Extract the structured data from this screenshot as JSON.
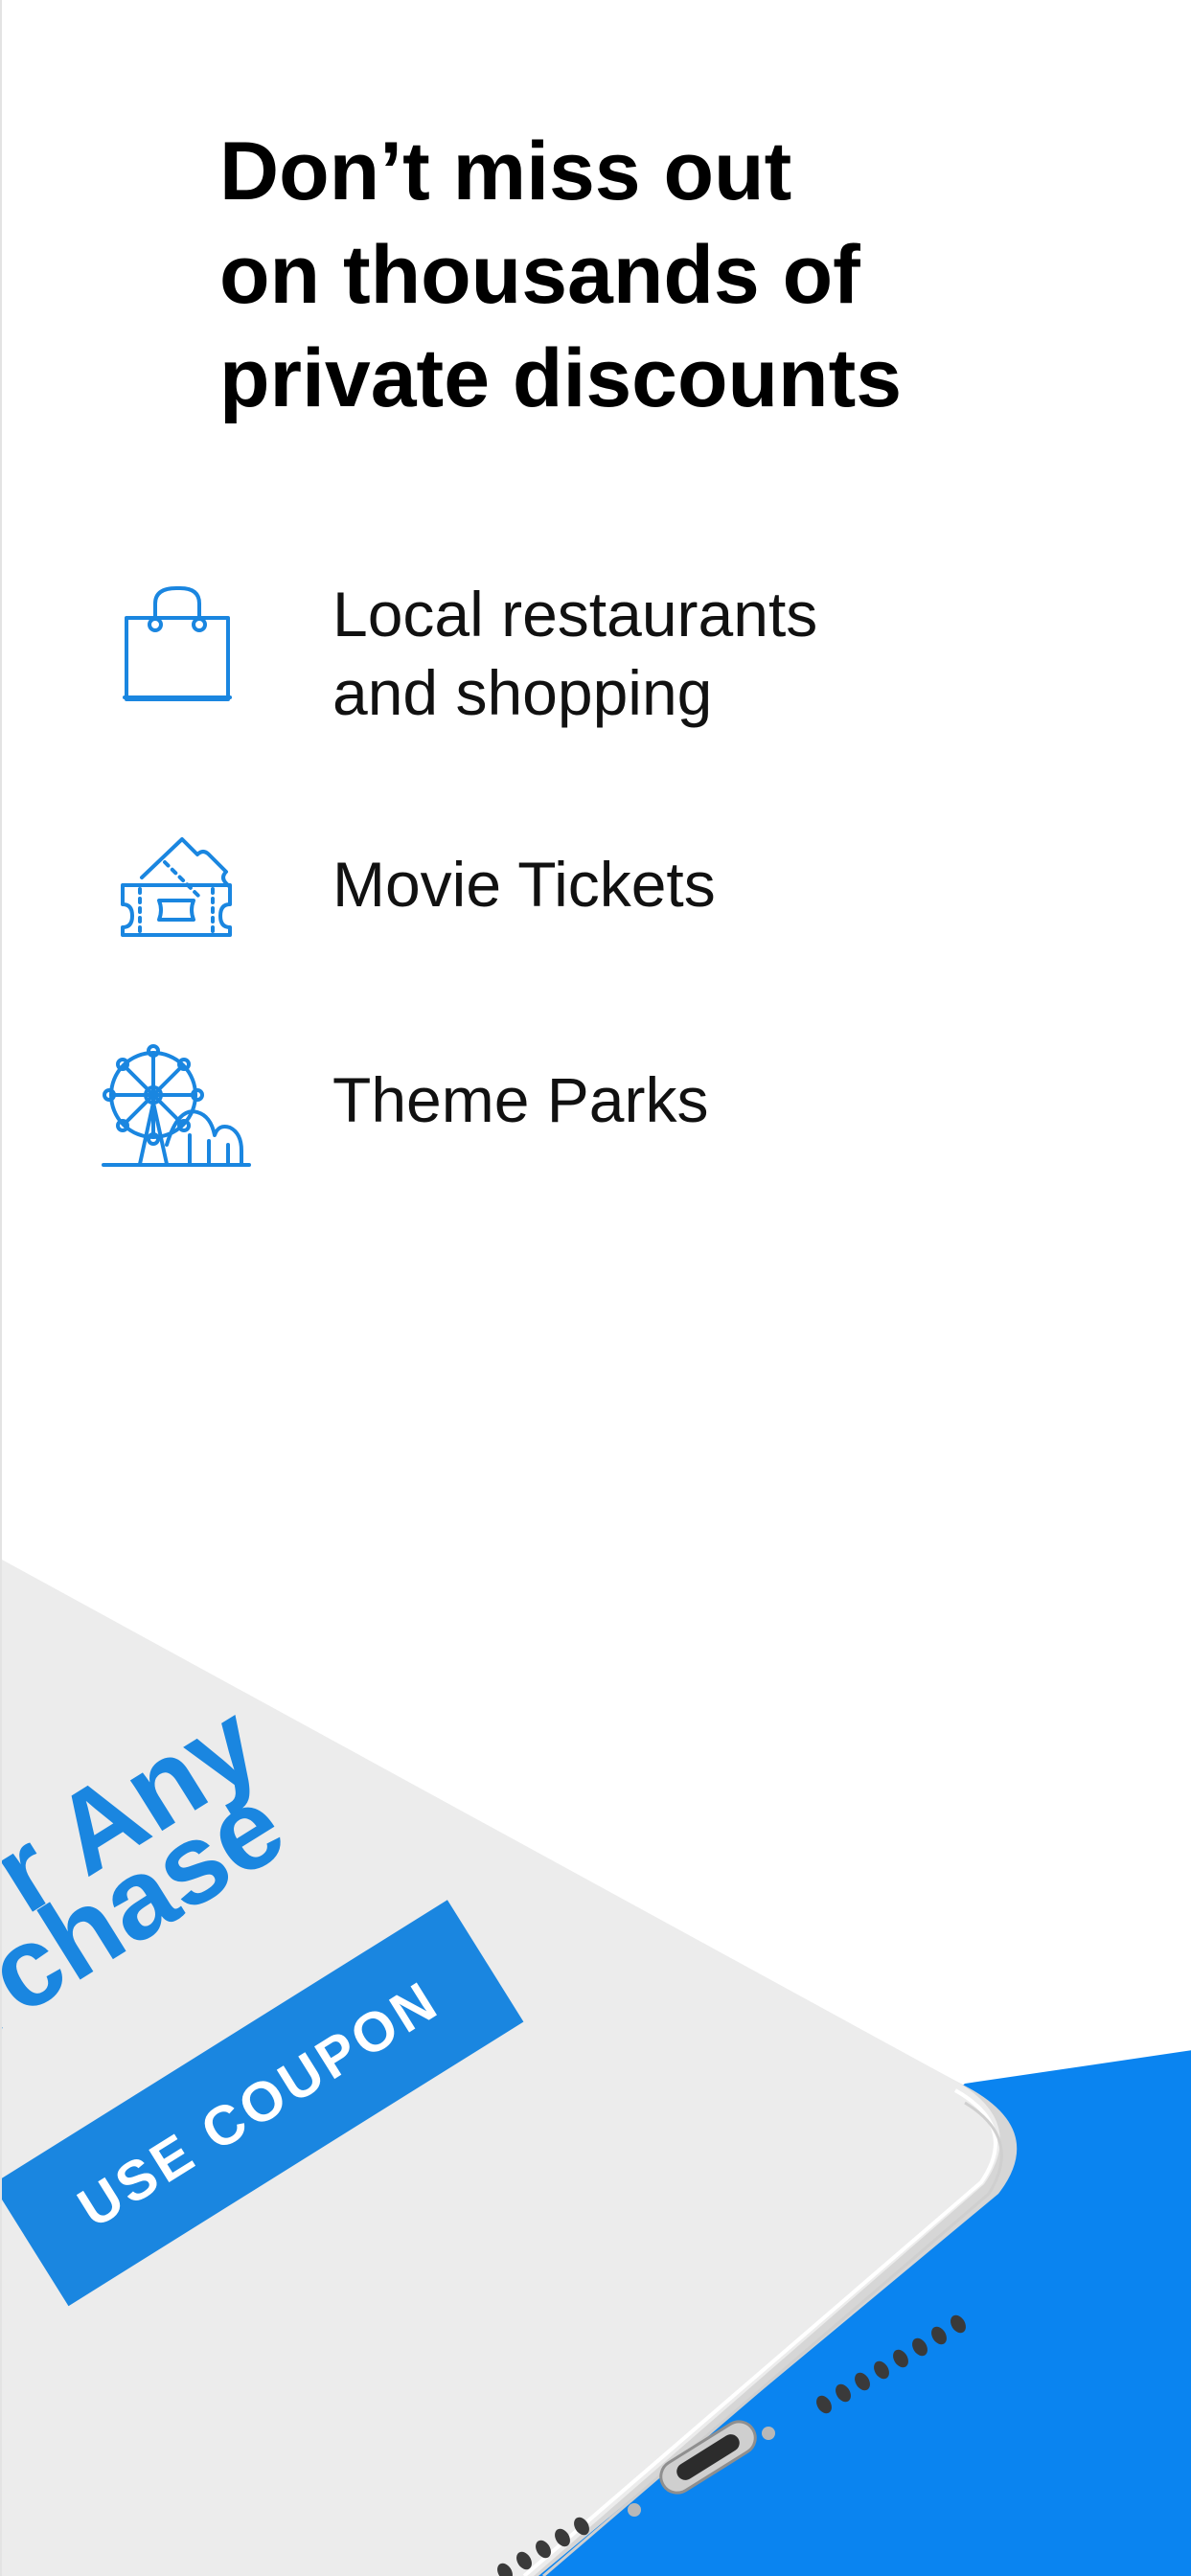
{
  "headline": {
    "line1": "Don’t miss out",
    "line2": "on thousands of",
    "line3": "private discounts"
  },
  "features": [
    {
      "icon": "shopping-bag-icon",
      "line1": "Local restaurants",
      "line2": "and shopping"
    },
    {
      "icon": "ticket-icon",
      "line1": "Movie Tickets"
    },
    {
      "icon": "theme-park-icon",
      "line1": "Theme Parks"
    }
  ],
  "phone": {
    "offer_line1": "r Any",
    "offer_line2": "rchase",
    "coupon_button": "USE COUPON"
  },
  "colors": {
    "accent_blue": "#0a84f0",
    "icon_blue": "#1a86e0",
    "phone_body": "#ececec"
  }
}
